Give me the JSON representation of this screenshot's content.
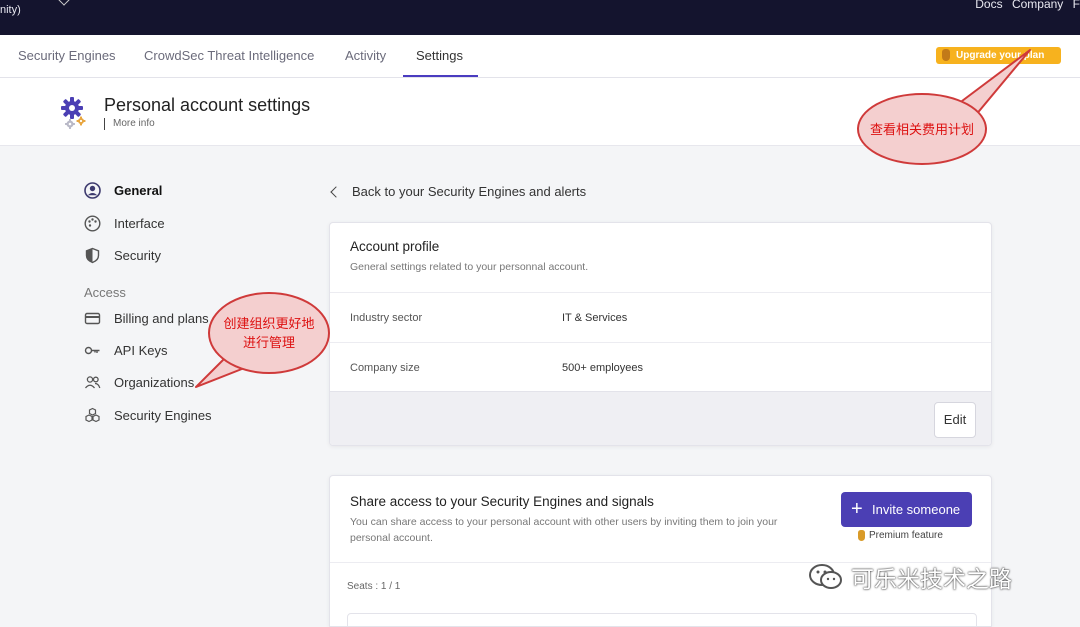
{
  "topbar": {
    "org_fragment": "nity)",
    "links": [
      "Docs",
      "Company",
      "F"
    ]
  },
  "tabs": [
    {
      "label": "Security Engines",
      "active": false
    },
    {
      "label": "CrowdSec Threat Intelligence",
      "active": false
    },
    {
      "label": "Activity",
      "active": false
    },
    {
      "label": "Settings",
      "active": true
    }
  ],
  "upgrade_label": "Upgrade your plan",
  "header": {
    "title": "Personal account settings",
    "more_info": "More info"
  },
  "sidebar": {
    "items": [
      {
        "label": "General",
        "icon": "user-circle-icon",
        "active": true
      },
      {
        "label": "Interface",
        "icon": "palette-icon"
      },
      {
        "label": "Security",
        "icon": "shield-icon"
      }
    ],
    "access_heading": "Access",
    "access_items": [
      {
        "label": "Billing and plans",
        "icon": "credit-card-icon"
      },
      {
        "label": "API Keys",
        "icon": "key-icon"
      },
      {
        "label": "Organizations",
        "icon": "users-icon"
      },
      {
        "label": "Security Engines",
        "icon": "cubes-icon"
      }
    ]
  },
  "back_link": "Back to your Security Engines and alerts",
  "account_profile": {
    "title": "Account profile",
    "subtitle": "General settings related to your personnal account.",
    "rows": [
      {
        "key": "Industry sector",
        "value": "IT & Services"
      },
      {
        "key": "Company size",
        "value": "500+ employees"
      }
    ],
    "edit_label": "Edit"
  },
  "share_access": {
    "title": "Share access to your Security Engines and signals",
    "description": "You can share access to your personal account with other users by inviting them to join your personal account.",
    "invite_label": "Invite someone",
    "premium_label": "Premium feature",
    "seats": "Seats : 1 / 1"
  },
  "annotations": {
    "plan_callout": "查看相关费用计划",
    "org_callout_line1": "创建组织更好地",
    "org_callout_line2": "进行管理",
    "callout_color": "#cf3a3a"
  },
  "watermark": "可乐米技术之路",
  "colors": {
    "accent": "#4b3fb4",
    "topbar": "#14142e",
    "upgrade": "#f7b21e"
  }
}
